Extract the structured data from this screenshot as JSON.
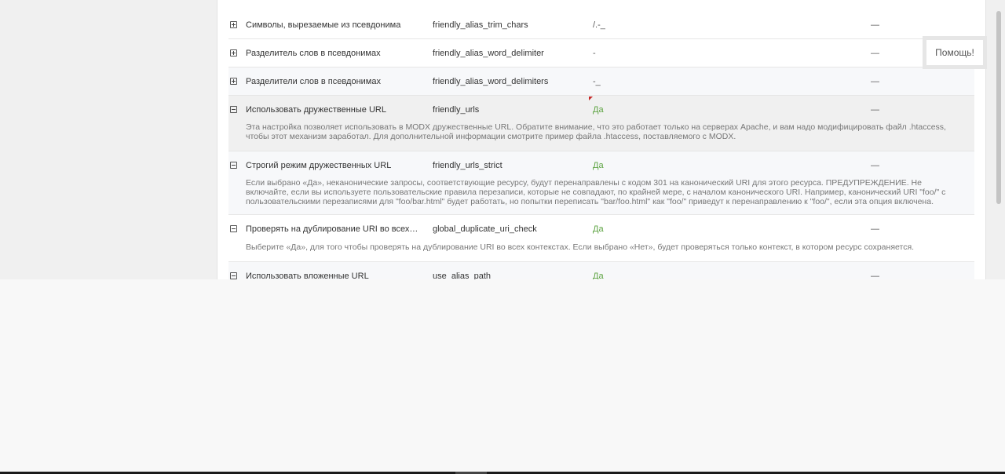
{
  "settings": {
    "rows": [
      {
        "name": "Символы, вырезаемые из псевдонима",
        "key": "friendly_alias_trim_chars",
        "value": "/.-_",
        "dash": "—",
        "expanded": false
      },
      {
        "name": "Разделитель слов в псевдонимах",
        "key": "friendly_alias_word_delimiter",
        "value": "-",
        "dash": "—",
        "expanded": false
      },
      {
        "name": "Разделители слов в псевдонимах",
        "key": "friendly_alias_word_delimiters",
        "value": "-_",
        "dash": "—",
        "expanded": false
      },
      {
        "name": "Использовать дружественные URL",
        "key": "friendly_urls",
        "value": "Да",
        "dash": "—",
        "expanded": true,
        "description": "Эта настройка позволяет использовать в MODX дружественные URL. Обратите внимание, что это работает только на серверах Apache, и вам надо модифицировать файл .htaccess, чтобы этот механизм заработал. Для дополнительной информации смотрите пример файла .htaccess, поставляемого с MODX."
      },
      {
        "name": "Строгий режим дружественных URL",
        "key": "friendly_urls_strict",
        "value": "Да",
        "dash": "—",
        "expanded": true,
        "description": "Если выбрано «Да», неканонические запросы, соответствующие ресурсу, будут перенаправлены с кодом 301 на канонический URI для этого ресурса. ПРЕДУПРЕЖДЕНИЕ. Не включайте, если вы используете пользовательские правила перезаписи, которые не совпадают, по крайней мере, с началом канонического URI. Например, канонический URI \"foo/\" с пользовательскими перезаписями для \"foo/bar.html\" будет работать, но попытки переписать \"bar/foo.html\" как \"foo/\" приведут к перенаправлению к \"foo/\", если эта опция включена."
      },
      {
        "name": "Проверять на дублирование URI во всех ко...",
        "key": "global_duplicate_uri_check",
        "value": "Да",
        "dash": "—",
        "expanded": true,
        "description": "Выберите «Да», для того чтобы проверять на дублирование URI во всех контекстах. Если выбрано «Нет», будет проверяться только контекст, в котором ресурс сохраняется."
      },
      {
        "name": "Использовать вложенные URL",
        "key": "use_alias_path",
        "value": "Да",
        "dash": "—",
        "expanded": false
      }
    ]
  },
  "help": {
    "label": "Помощь!"
  },
  "colors": {
    "yes_value": "#5ea443",
    "dirty_marker": "#c62828"
  }
}
